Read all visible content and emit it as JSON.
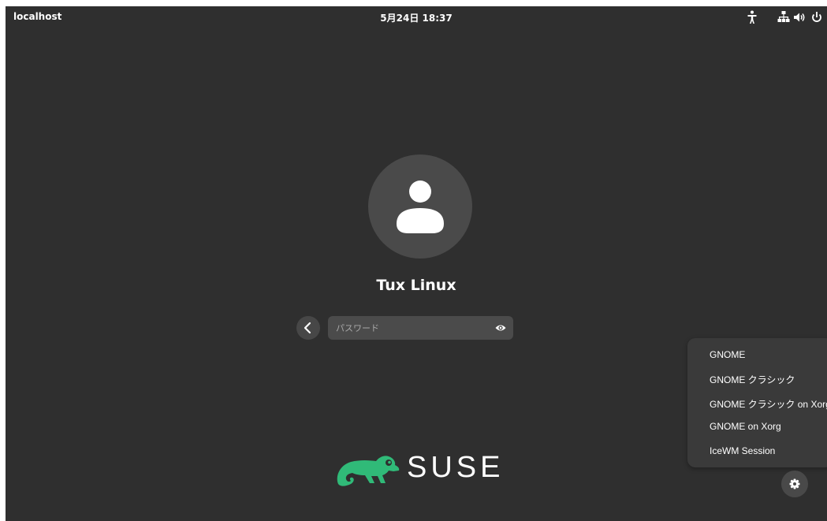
{
  "topbar": {
    "hostname": "localhost",
    "datetime": "5月24日 18:37",
    "icons": [
      "accessibility-icon",
      "network-icon",
      "volume-icon",
      "power-icon"
    ]
  },
  "login": {
    "avatar_icon": "user-avatar-icon",
    "username": "Tux Linux",
    "password_placeholder": "パスワード",
    "back_icon": "chevron-left-icon",
    "reveal_icon": "eye-icon"
  },
  "session_menu": {
    "items": [
      "GNOME",
      "GNOME クラシック",
      "GNOME クラシック on Xorg",
      "GNOME on Xorg",
      "IceWM Session"
    ]
  },
  "settings_icon": "gear-icon",
  "brand": {
    "text": "SUSE",
    "logo_color": "#30ba78"
  },
  "colors": {
    "background": "#2f2f2f",
    "menu_background": "#3a3a3a",
    "input_background": "#4b4b4b",
    "text": "#ffffff"
  }
}
